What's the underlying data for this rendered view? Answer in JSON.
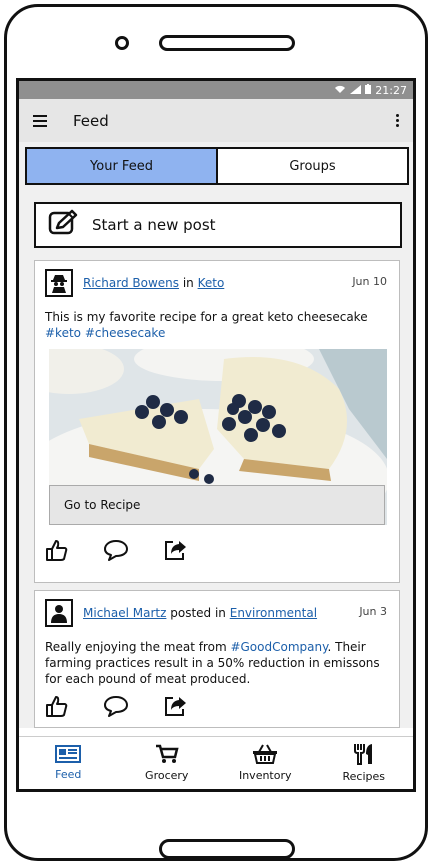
{
  "status_bar": {
    "time": "21:27"
  },
  "app_bar": {
    "title": "Feed"
  },
  "tabs": [
    {
      "label": "Your Feed"
    },
    {
      "label": "Groups"
    }
  ],
  "new_post": {
    "label": "Start a new post"
  },
  "posts": [
    {
      "author": "Richard Bowens",
      "connector": " in ",
      "group": "Keto",
      "date": "Jun 10",
      "text": "This is my favorite recipe for a great keto cheesecake",
      "tags": "#keto #cheesecake",
      "button": "Go to Recipe"
    },
    {
      "author": "Michael Martz",
      "connector": " posted in ",
      "group": "Environmental",
      "date": "Jun 3",
      "text_before": "Really enjoying the meat from ",
      "tag": "#GoodCompany",
      "text_after": ". Their farming practices result in a 50% reduction in emissons for each pound of meat produced."
    }
  ],
  "bottom_nav": [
    {
      "label": "Feed"
    },
    {
      "label": "Grocery"
    },
    {
      "label": "Inventory"
    },
    {
      "label": "Recipes"
    }
  ],
  "colors": {
    "active_tab": "#8fb3f0",
    "link": "#1c5faa",
    "app_bar": "#e6e6e6",
    "status_bar": "#8f8f8f"
  },
  "icons": [
    "menu-icon",
    "more-vert-icon",
    "edit-icon",
    "spy-avatar-icon",
    "person-avatar-icon",
    "like-icon",
    "comment-icon",
    "share-icon",
    "feed-icon",
    "cart-icon",
    "basket-icon",
    "utensils-icon"
  ]
}
